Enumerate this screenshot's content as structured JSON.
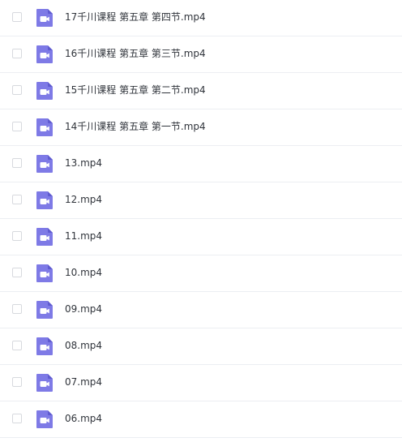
{
  "file_list": {
    "icon": "video-file-icon",
    "icon_color": "#7e7ae6",
    "items": [
      {
        "name": "17千川课程 第五章 第四节.mp4"
      },
      {
        "name": "16千川课程 第五章 第三节.mp4"
      },
      {
        "name": "15千川课程 第五章 第二节.mp4"
      },
      {
        "name": "14千川课程 第五章 第一节.mp4"
      },
      {
        "name": "13.mp4"
      },
      {
        "name": "12.mp4"
      },
      {
        "name": "11.mp4"
      },
      {
        "name": "10.mp4"
      },
      {
        "name": "09.mp4"
      },
      {
        "name": "08.mp4"
      },
      {
        "name": "07.mp4"
      },
      {
        "name": "06.mp4"
      }
    ]
  }
}
